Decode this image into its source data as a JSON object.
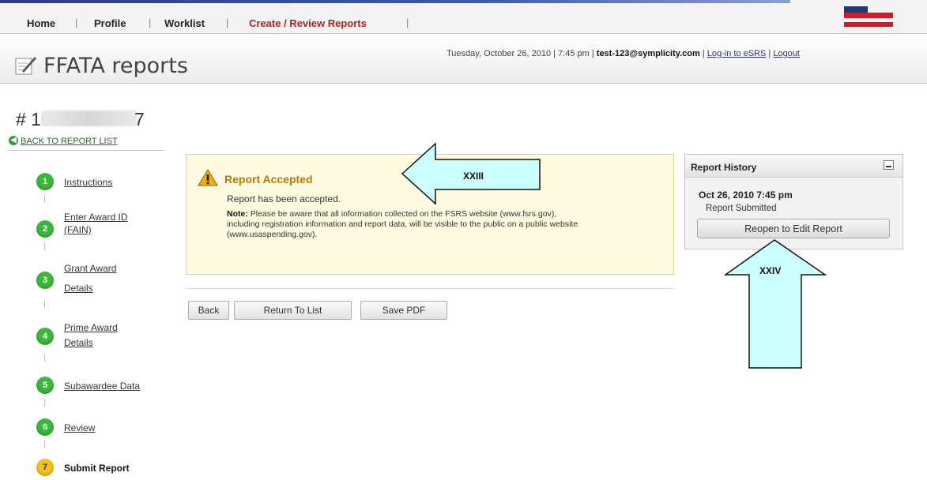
{
  "nav": {
    "items": [
      {
        "label": "Home"
      },
      {
        "label": "Profile"
      },
      {
        "label": "Worklist"
      },
      {
        "label": "Create / Review Reports"
      }
    ]
  },
  "header": {
    "title": "FFATA reports",
    "date": "Tuesday, October 26, 2010 | 7:45 pm |",
    "user": "test-123@symplicity.com",
    "sep": "|",
    "esrs_link": "Log-in to eSRS",
    "logout": "Logout"
  },
  "report": {
    "id_prefix": "# 10",
    "id_suffix": "7",
    "back_link": "BACK TO REPORT LIST"
  },
  "steps": [
    {
      "num": "1",
      "label_lines": [
        "Instructions"
      ]
    },
    {
      "num": "2",
      "label_lines": [
        "Enter Award ID",
        "(FAIN)"
      ]
    },
    {
      "num": "3",
      "label_lines": [
        "Grant Award",
        "Details"
      ]
    },
    {
      "num": "4",
      "label_lines": [
        "Prime Award",
        "Details"
      ]
    },
    {
      "num": "5",
      "label_lines": [
        "Subawardee Data"
      ]
    },
    {
      "num": "6",
      "label_lines": [
        "Review"
      ]
    },
    {
      "num": "7",
      "label_lines": [
        "Submit Report"
      ]
    }
  ],
  "accepted": {
    "title": "Report Accepted",
    "message": "Report has been accepted.",
    "note_label": "Note:",
    "note_text": " Please be aware that all information collected on the FSRS website (www.fsrs.gov), including registration information and report data, will be visible to the public on a public website (www.usaspending.gov)."
  },
  "buttons": {
    "back": "Back",
    "return": "Return To List",
    "save_pdf": "Save PDF"
  },
  "history": {
    "title": "Report History",
    "date": "Oct 26, 2010 7:45 pm",
    "status": "Report Submitted",
    "reopen": "Reopen to Edit Report"
  },
  "callouts": {
    "xxiii": "XXIII",
    "xxiv": "XXIV"
  },
  "colors": {
    "step_done": "#3bb83b",
    "step_current": "#f2c21c",
    "callout_fill": "#ccffff",
    "accepted_bg": "#fffbe0"
  }
}
